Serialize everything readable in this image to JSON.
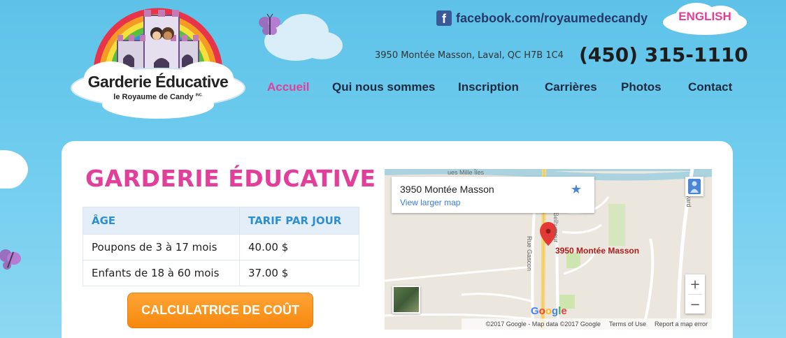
{
  "header": {
    "logo_title": "Garderie Éducative",
    "logo_subtitle": "le Royaume de Candy",
    "logo_subtitle_suffix": "INC.",
    "facebook_text": "facebook.com/royaumedecandy",
    "language_link": "ENGLISH",
    "address": "3950 Montée Masson, Laval, QC H7B 1C4",
    "phone": "(450) 315-1110"
  },
  "nav": {
    "items": [
      {
        "label": "Accueil",
        "active": true
      },
      {
        "label": "Qui nous sommes",
        "active": false
      },
      {
        "label": "Inscription",
        "active": false
      },
      {
        "label": "Carrières",
        "active": false
      },
      {
        "label": "Photos",
        "active": false
      },
      {
        "label": "Contact",
        "active": false
      }
    ]
  },
  "main": {
    "heading": "GARDERIE ÉDUCATIVE",
    "table": {
      "headers": [
        "ÂGE",
        "TARIF PAR JOUR"
      ],
      "rows": [
        [
          "Poupons de 3 à 17 mois",
          "40.00 $"
        ],
        [
          "Enfants de 18 à 60 mois",
          "37.00 $"
        ]
      ]
    },
    "calc_button": "CALCULATRICE DE COÛT"
  },
  "map": {
    "info_address": "3950 Montée Masson",
    "view_larger": "View larger map",
    "pin_label": "3950 Montée Masson",
    "zoom_in": "+",
    "zoom_out": "−",
    "google_letters": [
      "G",
      "o",
      "o",
      "g",
      "l",
      "e"
    ],
    "footer": [
      "©2017 Google - Map data ©2017 Google",
      "Terms of Use",
      "Report a map error"
    ],
    "street_labels": {
      "gascon": "Rue Gascon",
      "belhumeur": "Belhumeur",
      "mille_iles": "ues Mille Îles",
      "boulevard": "oulevard"
    }
  },
  "colors": {
    "accent_pink": "#e13f9a",
    "nav_dark": "#1f2a40",
    "table_header": "#2d8fd1",
    "button_orange": "#f7880e",
    "sky": "#6ccbee"
  },
  "icons": [
    "facebook-icon",
    "butterfly-icon",
    "star-icon",
    "pegman-icon",
    "map-pin-icon"
  ]
}
